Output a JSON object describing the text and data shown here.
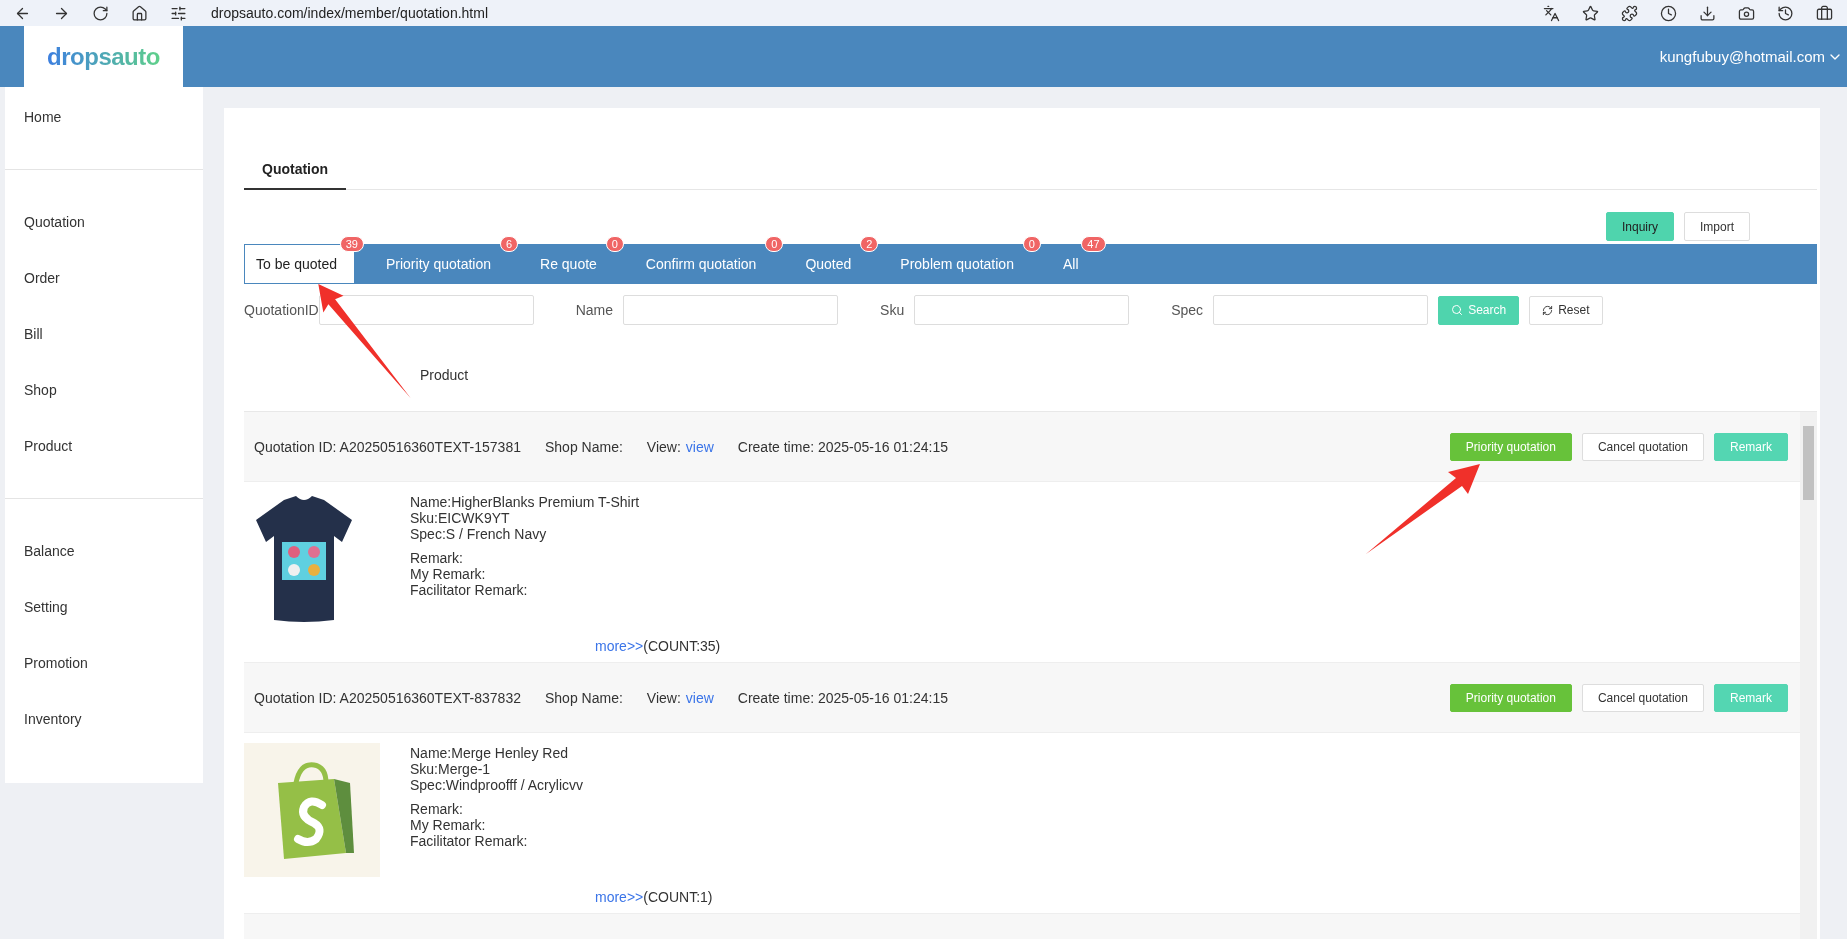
{
  "browser": {
    "url": "dropsauto.com/index/member/quotation.html"
  },
  "header": {
    "logo": "dropsauto",
    "user": "kungfubuy@hotmail.com"
  },
  "sidebar": {
    "groups": [
      {
        "items": [
          {
            "label": "Home"
          }
        ]
      },
      {
        "items": [
          {
            "label": "Quotation"
          },
          {
            "label": "Order"
          },
          {
            "label": "Bill"
          },
          {
            "label": "Shop"
          },
          {
            "label": "Product"
          }
        ]
      },
      {
        "items": [
          {
            "label": "Balance"
          },
          {
            "label": "Setting"
          },
          {
            "label": "Promotion"
          },
          {
            "label": "Inventory"
          }
        ]
      }
    ]
  },
  "page_tabs": [
    {
      "label": "Quotation",
      "selected": true
    }
  ],
  "actions": [
    {
      "label": "Inquiry",
      "kind": "primary"
    },
    {
      "label": "Import",
      "kind": "default"
    }
  ],
  "status_tabs": [
    {
      "label": "To be quoted",
      "count": "39",
      "selected": true
    },
    {
      "label": "Priority quotation",
      "count": "6",
      "selected": false
    },
    {
      "label": "Re quote",
      "count": "0",
      "selected": false
    },
    {
      "label": "Confirm quotation",
      "count": "0",
      "selected": false
    },
    {
      "label": "Quoted",
      "count": "2",
      "selected": false
    },
    {
      "label": "Problem quotation",
      "count": "0",
      "selected": false
    },
    {
      "label": "All",
      "count": "47",
      "selected": false
    }
  ],
  "filters": [
    {
      "label": "QuotationID"
    },
    {
      "label": "Name"
    },
    {
      "label": "Sku"
    },
    {
      "label": "Spec"
    }
  ],
  "filter_buttons": [
    {
      "label": "Search",
      "kind": "search"
    },
    {
      "label": "Reset",
      "kind": "reset"
    }
  ],
  "table": {
    "columns": [
      "Product"
    ]
  },
  "quotations": [
    {
      "id": "Quotation ID: A20250516360TEXT-157381",
      "shop": "Shop Name:",
      "view_label": "View:",
      "view_link": "view",
      "created": "Create time: 2025-05-16 01:24:15",
      "kind": "tshirt",
      "buttons": [
        {
          "label": "Priority quotation",
          "kind": "priority"
        },
        {
          "label": "Cancel quotation",
          "kind": "default"
        },
        {
          "label": "Remark",
          "kind": "teal"
        }
      ],
      "details": [
        "Name:HigherBlanks Premium T-Shirt",
        "Sku:EICWK9YT",
        "Spec:S / French Navy"
      ],
      "remarks": [
        "Remark:",
        "My Remark:",
        "Facilitator Remark:"
      ],
      "more": "more>>",
      "count": "(COUNT:35)"
    },
    {
      "id": "Quotation ID: A20250516360TEXT-837832",
      "shop": "Shop Name:",
      "view_label": "View:",
      "view_link": "view",
      "created": "Create time: 2025-05-16 01:24:15",
      "kind": "shopify",
      "buttons": [
        {
          "label": "Priority quotation",
          "kind": "priority"
        },
        {
          "label": "Cancel quotation",
          "kind": "default"
        },
        {
          "label": "Remark",
          "kind": "teal"
        }
      ],
      "details": [
        "Name:Merge Henley Red",
        "Sku:Merge-1",
        "Spec:Windproofff / Acrylicvv"
      ],
      "remarks": [
        "Remark:",
        "My Remark:",
        "Facilitator Remark:"
      ],
      "more": "more>>",
      "count": "(COUNT:1)"
    }
  ]
}
